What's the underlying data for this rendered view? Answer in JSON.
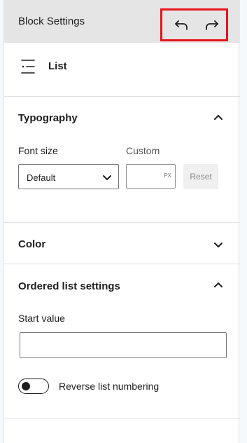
{
  "header": {
    "title": "Block Settings",
    "undo_icon": "undo-icon",
    "redo_icon": "redo-icon",
    "highlight_color": "#e8141c"
  },
  "block": {
    "icon": "list-icon",
    "name": "List"
  },
  "typography": {
    "title": "Typography",
    "expanded": true,
    "font_size_label": "Font size",
    "custom_label": "Custom",
    "font_size_value": "Default",
    "custom_value": "",
    "unit": "PX",
    "reset_label": "Reset"
  },
  "color": {
    "title": "Color",
    "expanded": false
  },
  "ordered": {
    "title": "Ordered list settings",
    "expanded": true,
    "start_value_label": "Start value",
    "start_value": "",
    "reverse_label": "Reverse list numbering",
    "reverse_on": false
  }
}
